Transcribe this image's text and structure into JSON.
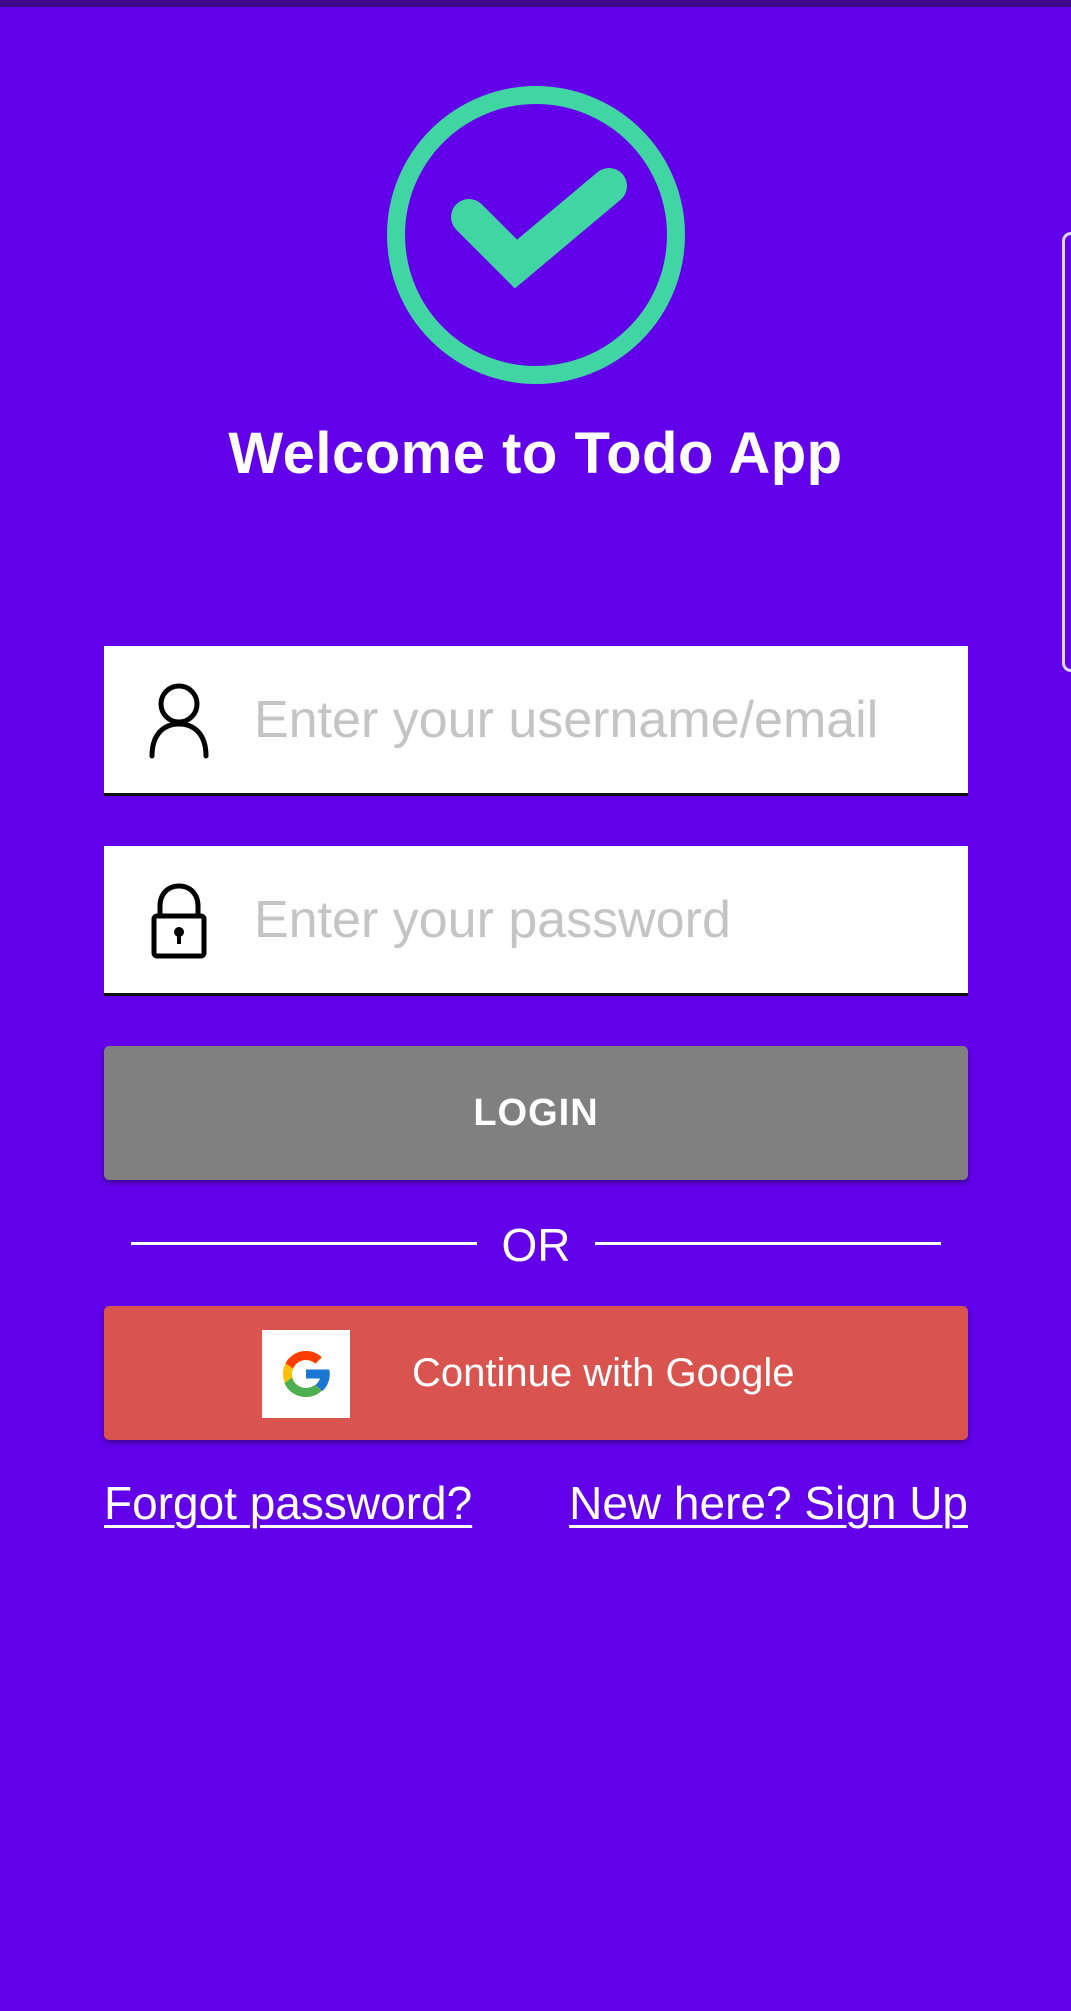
{
  "app": {
    "title": "Welcome to Todo App"
  },
  "login_form": {
    "username": {
      "placeholder": "Enter your username/email",
      "value": "",
      "icon": "person-icon"
    },
    "password": {
      "placeholder": "Enter your password",
      "value": "",
      "icon": "lock-icon"
    },
    "login_label": "LOGIN",
    "divider_label": "OR",
    "google_label": "Continue with Google",
    "google_icon": "google-icon"
  },
  "links": {
    "forgot_password": "Forgot password?",
    "sign_up": "New here? Sign Up"
  },
  "colors": {
    "background": "#6200EA",
    "logo_accent": "#41D5A4",
    "login_button": "#808080",
    "google_button": "#D9534F"
  },
  "logo_icon": "check-circle-icon"
}
